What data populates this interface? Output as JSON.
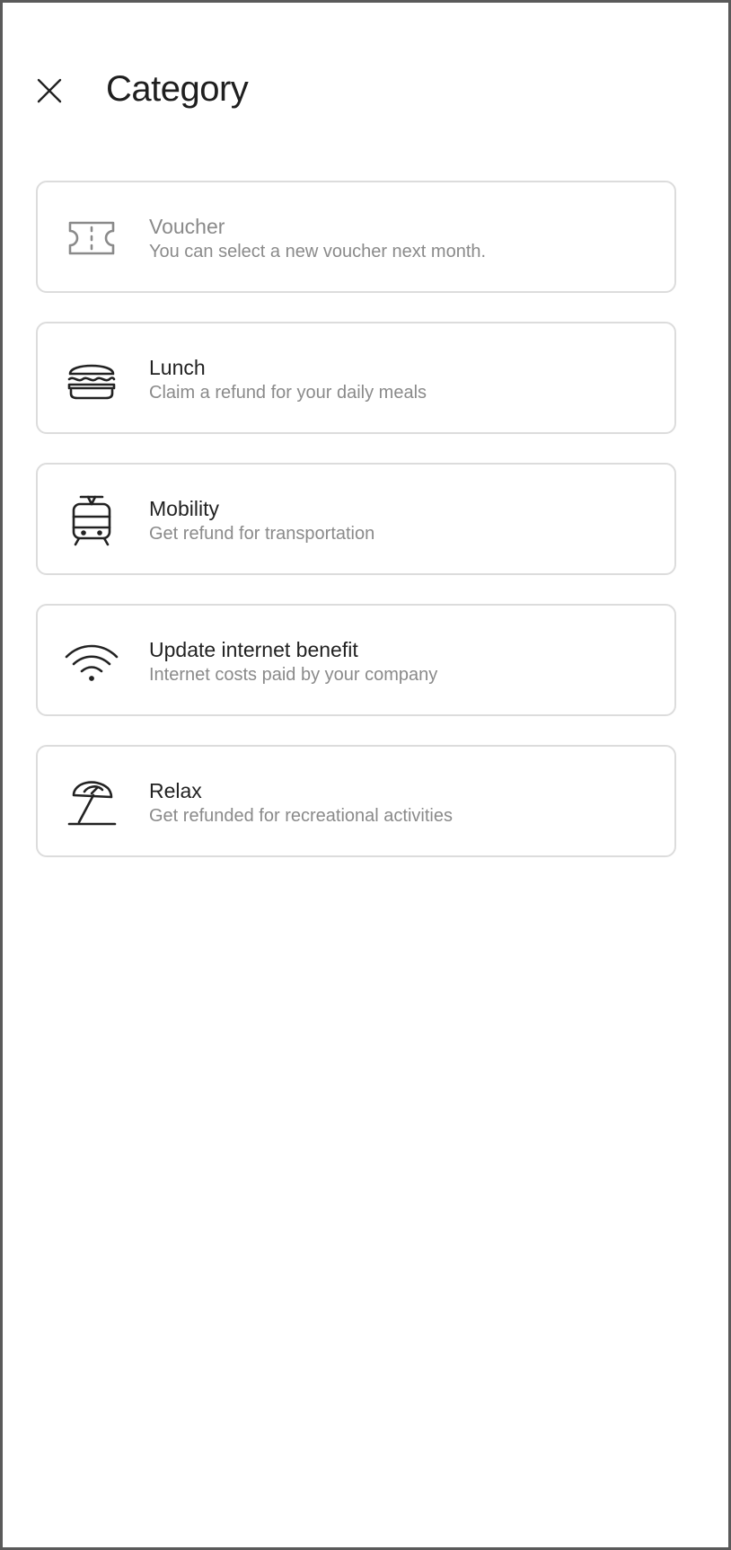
{
  "header": {
    "title": "Category",
    "close_icon": "close-icon"
  },
  "categories": [
    {
      "title": "Voucher",
      "subtitle": "You can select a new voucher next month.",
      "icon": "ticket-icon",
      "disabled": true
    },
    {
      "title": "Lunch",
      "subtitle": "Claim a refund for your daily meals",
      "icon": "burger-icon",
      "disabled": false
    },
    {
      "title": "Mobility",
      "subtitle": "Get refund for transportation",
      "icon": "tram-icon",
      "disabled": false
    },
    {
      "title": "Update internet benefit",
      "subtitle": "Internet costs paid by your company",
      "icon": "wifi-icon",
      "disabled": false
    },
    {
      "title": "Relax",
      "subtitle": "Get refunded for recreational activities",
      "icon": "beach-umbrella-icon",
      "disabled": false
    }
  ],
  "colors": {
    "text_primary": "#222222",
    "text_secondary": "#8a8a8a",
    "card_border": "#dcdcdc",
    "frame_border": "#5a5a5a"
  }
}
